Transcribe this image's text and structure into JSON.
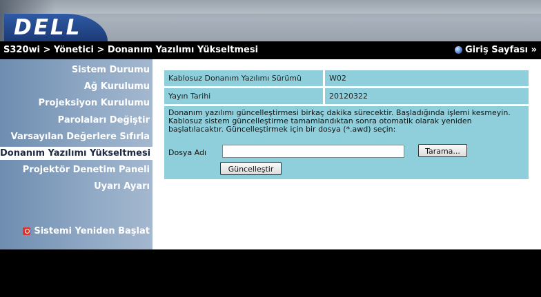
{
  "brand": {
    "logo_text": "DELL"
  },
  "titlebar": {
    "breadcrumb": "S320wi > Yönetici > Donanım Yazılımı Yükseltmesi",
    "home_link": "Giriş Sayfası »"
  },
  "sidebar": {
    "items": [
      {
        "label": "Sistem Durumu"
      },
      {
        "label": "Ağ Kurulumu"
      },
      {
        "label": "Projeksiyon Kurulumu"
      },
      {
        "label": "Parolaları Değiştir"
      },
      {
        "label": "Varsayılan Değerlere Sıfırla"
      },
      {
        "label": "Donanım Yazılımı Yükseltmesi",
        "active": true
      },
      {
        "label": "Projektör Denetim Paneli"
      },
      {
        "label": "Uyarı Ayarı"
      }
    ],
    "reboot_label": "Sistemi Yeniden Başlat"
  },
  "main": {
    "rows": [
      {
        "label": "Kablosuz Donanım Yazılımı Sürümü",
        "value": "W02"
      },
      {
        "label": "Yayın Tarihi",
        "value": "20120322"
      }
    ],
    "info_text": "Donanım yazılımı güncelleştirmesi birkaç dakika sürecektir.  Başladığında işlemi kesmeyin. Kablosuz sistem güncelleştirme tamamlandıktan sonra otomatik olarak yeniden başlatılacaktır. Güncelleştirmek için bir dosya (*.awd) seçin:",
    "file_label": "Dosya Adı",
    "file_value": "",
    "browse_label": "Tarama...",
    "update_label": "Güncelleştir"
  },
  "colors": {
    "accent": "#8fcfdb",
    "sidebar": "#90a9c5",
    "logo": "#2f5aa5"
  }
}
